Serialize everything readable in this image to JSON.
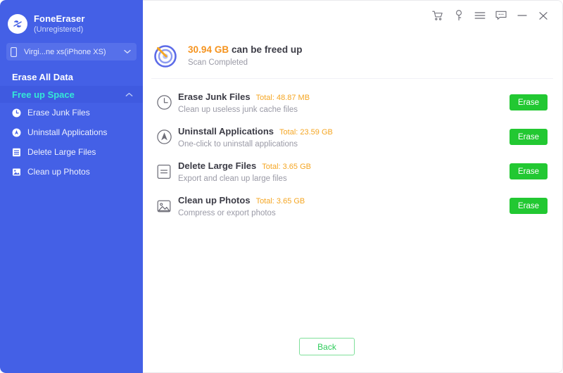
{
  "sidebar": {
    "brand": {
      "name": "FoneEraser",
      "status": "(Unregistered)",
      "logo_icon": "eraser-logo-icon"
    },
    "device": {
      "name": "Virgi...ne xs(iPhone XS)",
      "phone_icon": "phone-icon",
      "caret_icon": "chevron-down-icon"
    },
    "erase_all_label": "Erase All Data",
    "group": {
      "title": "Free up Space",
      "caret_icon": "chevron-up-icon",
      "items": [
        {
          "label": "Erase Junk Files",
          "icon": "clock-icon"
        },
        {
          "label": "Uninstall Applications",
          "icon": "compass-icon"
        },
        {
          "label": "Delete Large Files",
          "icon": "file-lines-icon"
        },
        {
          "label": "Clean up Photos",
          "icon": "photo-icon"
        }
      ]
    }
  },
  "titlebar": {
    "buttons": [
      {
        "name": "cart-icon",
        "title": "Buy"
      },
      {
        "name": "key-icon",
        "title": "Register"
      },
      {
        "name": "menu-icon",
        "title": "Menu"
      },
      {
        "name": "feedback-icon",
        "title": "Feedback"
      },
      {
        "name": "minimize-icon",
        "title": "Minimize"
      },
      {
        "name": "close-icon",
        "title": "Close"
      }
    ]
  },
  "summary": {
    "icon": "scan-target-icon",
    "amount": "30.94 GB",
    "headline_rest": " can be freed up",
    "status": "Scan Completed"
  },
  "list": {
    "rows": [
      {
        "icon": "clock-icon",
        "title": "Erase Junk Files",
        "total": "Total: 48.87 MB",
        "desc": "Clean up useless junk cache files",
        "action": "Erase"
      },
      {
        "icon": "compass-icon",
        "title": "Uninstall Applications",
        "total": "Total: 23.59 GB",
        "desc": "One-click to uninstall applications",
        "action": "Erase"
      },
      {
        "icon": "file-lines-icon",
        "title": "Delete Large Files",
        "total": "Total: 3.65 GB",
        "desc": "Export and clean up large files",
        "action": "Erase"
      },
      {
        "icon": "photo-icon",
        "title": "Clean up Photos",
        "total": "Total: 3.65 GB",
        "desc": "Compress or export photos",
        "action": "Erase"
      }
    ]
  },
  "footer": {
    "back_label": "Back"
  },
  "colors": {
    "sidebar_blue": "#4460E6",
    "sidebar_active": "#3F5AE0",
    "accent_cyan": "#34E8D6",
    "accent_orange": "#F5A623",
    "button_green": "#22C832",
    "text_dark": "#3C3C46",
    "text_muted": "#9A9AA6"
  }
}
